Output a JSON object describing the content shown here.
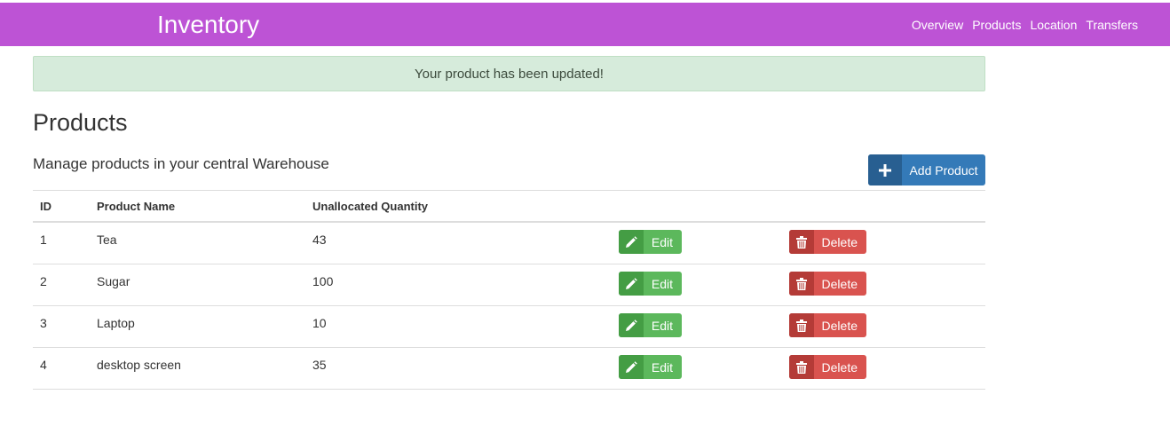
{
  "header": {
    "brand": "Inventory",
    "nav": [
      "Overview",
      "Products",
      "Location",
      "Transfers"
    ],
    "color": "#bd53d5"
  },
  "alert": {
    "message": "Your product has been updated!"
  },
  "page": {
    "title": "Products",
    "subtitle": "Manage products in your central Warehouse",
    "add_button": "Add Product"
  },
  "table": {
    "headers": [
      "ID",
      "Product Name",
      "Unallocated Quantity"
    ],
    "edit_label": "Edit",
    "delete_label": "Delete",
    "rows": [
      {
        "id": "1",
        "name": "Tea",
        "qty": "43"
      },
      {
        "id": "2",
        "name": "Sugar",
        "qty": "100"
      },
      {
        "id": "3",
        "name": "Laptop",
        "qty": "10"
      },
      {
        "id": "4",
        "name": "desktop screen",
        "qty": "35"
      }
    ]
  },
  "icons": {
    "add": "plus-icon",
    "edit": "pencil-icon",
    "delete": "trash-icon"
  }
}
